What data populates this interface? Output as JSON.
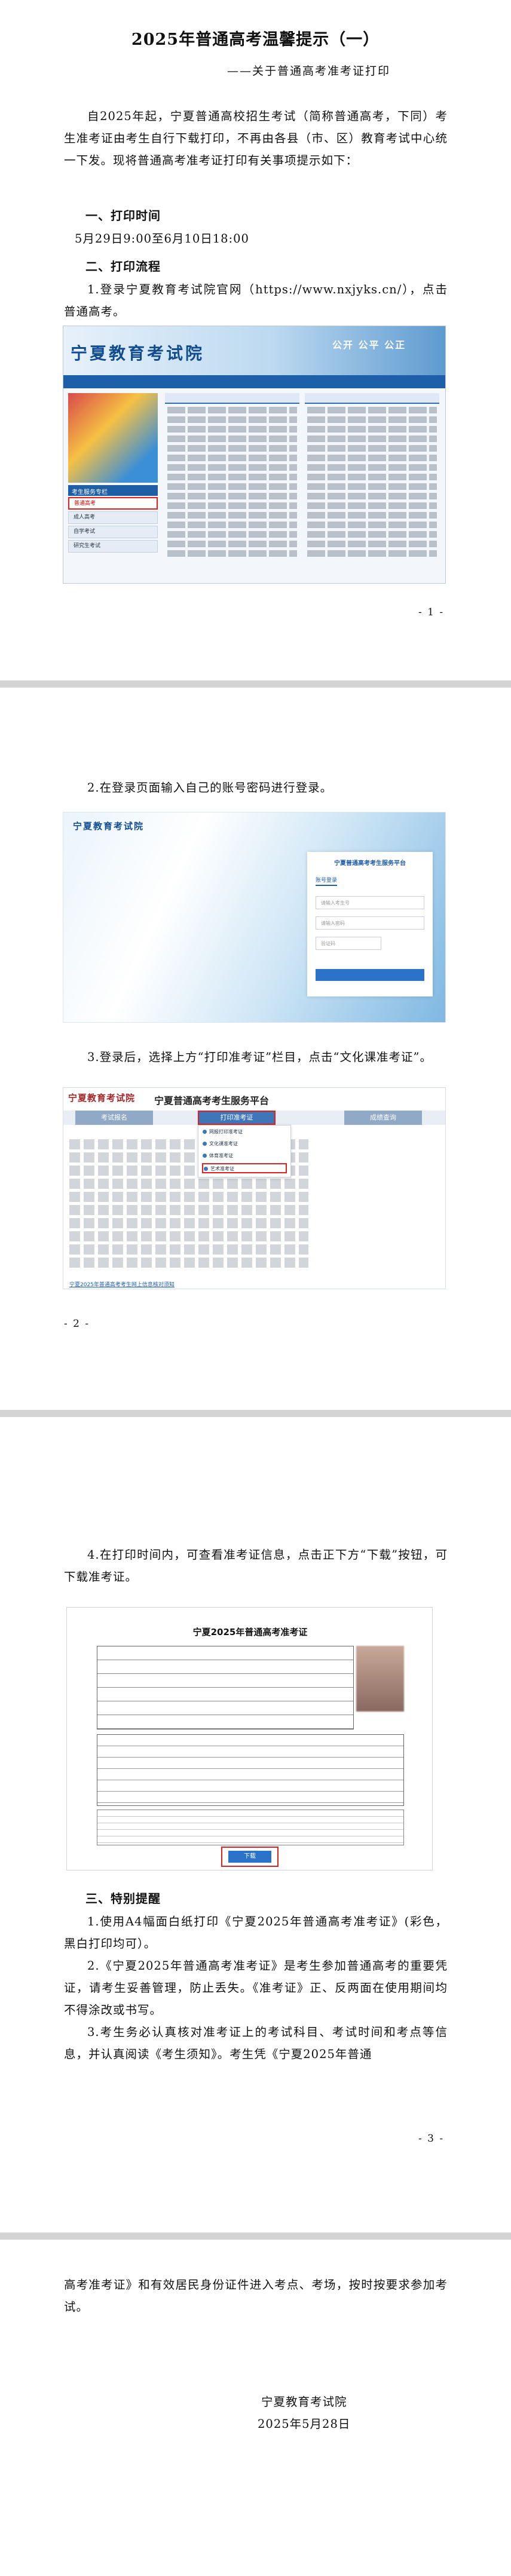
{
  "page1": {
    "title": "2025年普通高考温馨提示（一）",
    "subtitle": "——关于普通高考准考证打印",
    "intro": "自2025年起，宁夏普通高校招生考试（简称普通高考，下同）考生准考证由考生自行下载打印，不再由各县（市、区）教育考试中心统一下发。现将普通高考准考证打印有关事项提示如下：",
    "h1": "一、打印时间",
    "time": "5月29日9:00至6月10日18:00",
    "h2": "二、打印流程",
    "step1": "1.登录宁夏教育考试院官网（https://www.nxjyks.cn/），点击普通高考。",
    "page_no": "- 1 -",
    "shot": {
      "logo": "宁夏教育考试院",
      "slogan": "公开  公平  公正",
      "side_title": "考生服务专栏",
      "side_items": [
        "普通高考",
        "成人高考",
        "自学考试",
        "研究生考试"
      ]
    }
  },
  "page2": {
    "step2": "2.在登录页面输入自己的账号密码进行登录。",
    "step3": "3.登录后，选择上方“打印准考证”栏目，点击“文化课准考证”。",
    "page_no": "- 2 -",
    "login": {
      "logo": "宁夏教育考试院",
      "panel_title": "宁夏普通高考考生服务平台",
      "tab": "账号登录",
      "user_placeholder": "请输入考生号",
      "pass_placeholder": "请输入密码",
      "code_placeholder": "验证码"
    },
    "portal": {
      "logo": "宁夏教育考试院",
      "title": "宁夏普通高考考生服务平台",
      "steps": [
        "考试报名",
        "打印准考证",
        "成绩查询"
      ],
      "menu": [
        "网报打印准考证",
        "文化课准考证",
        "体育准考证",
        "艺术准考证"
      ],
      "link": "宁夏2025年普通高考考生网上信息核对须知"
    }
  },
  "page3": {
    "step4": "4.在打印时间内，可查看准考证信息，点击正下方“下载”按钮，可下载准考证。",
    "ticket": {
      "title": "宁夏2025年普通高考准考证",
      "download": "下载"
    },
    "h3": "三、特别提醒",
    "r1": "1.使用A4幅面白纸打印《宁夏2025年普通高考准考证》(彩色，黑白打印均可）。",
    "r2": "2.《宁夏2025年普通高考准考证》是考生参加普通高考的重要凭证，请考生妥善管理，防止丢失。《准考证》正、反两面在使用期间均不得涂改或书写。",
    "r3": "3.考生务必认真核对准考证上的考试科目、考试时间和考点等信息，并认真阅读《考生须知》。考生凭《宁夏2025年普通",
    "page_no": "- 3 -"
  },
  "page4": {
    "cont": "高考准考证》和有效居民身份证件进入考点、考场，按时按要求参加考试。",
    "org": "宁夏教育考试院",
    "date": "2025年5月28日"
  }
}
